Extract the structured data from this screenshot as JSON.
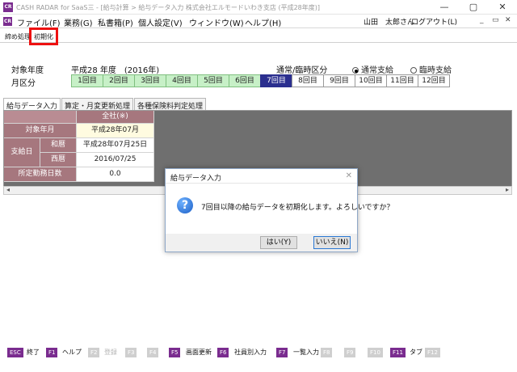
{
  "window": {
    "title": "CASH RADAR for SaaS三 - [給与計算 > 給与データ入力 株式会社エルモードいわき支店 (平成28年度)]",
    "app_icon": "CR"
  },
  "menu": {
    "items": [
      "ファイル(F)",
      "業務(G)",
      "私書箱(P)",
      "個人設定(V)",
      "ウィンドウ(W)",
      "ヘルプ(H)"
    ],
    "user": "山田　太郎さん",
    "logout": "ログアウト(L)"
  },
  "toolbar": {
    "items": [
      "締め処理",
      "初期化"
    ]
  },
  "header": {
    "year_label": "対象年度",
    "year_value": "平成28 年度　(2016年)",
    "type_label": "通常/臨時区分",
    "type_options": [
      "通常支給",
      "臨時支給"
    ],
    "type_selected": "通常支給",
    "month_label": "月区分",
    "periods": [
      "1回目",
      "2回目",
      "3回目",
      "4回目",
      "5回目",
      "6回目",
      "7回目",
      "8回目",
      "9回目",
      "10回目",
      "11回目",
      "12回目"
    ],
    "selected_period": "7回目"
  },
  "tabs": [
    "給与データ入力",
    "算定・月変更新処理",
    "各種保険料判定処理"
  ],
  "grid": {
    "company_header": "全社(※)",
    "target_month_label": "対象年月",
    "target_month_value": "平成28年07月",
    "payday_label": "支給日",
    "wareki_label": "和暦",
    "wareki_value": "平成28年07月25日",
    "seireki_label": "西暦",
    "seireki_value": "2016/07/25",
    "workdays_label": "所定勤務日数",
    "workdays_value": "0.0"
  },
  "dialog": {
    "title": "給与データ入力",
    "message": "7回目以降の給与データを初期化します。よろしいですか？",
    "yes": "はい(Y)",
    "no": "いいえ(N)"
  },
  "fkeys": [
    {
      "key": "ESC",
      "label": "終了",
      "enabled": true
    },
    {
      "key": "F1",
      "label": "ヘルプ",
      "enabled": true
    },
    {
      "key": "F2",
      "label": "登録",
      "enabled": false
    },
    {
      "key": "F3",
      "label": "",
      "enabled": false
    },
    {
      "key": "F4",
      "label": "",
      "enabled": false
    },
    {
      "key": "F5",
      "label": "画面更新",
      "enabled": true
    },
    {
      "key": "F6",
      "label": "社員別入力",
      "enabled": true
    },
    {
      "key": "F7",
      "label": "一覧入力",
      "enabled": true
    },
    {
      "key": "F8",
      "label": "",
      "enabled": false
    },
    {
      "key": "F9",
      "label": "",
      "enabled": false
    },
    {
      "key": "F10",
      "label": "",
      "enabled": false
    },
    {
      "key": "F11",
      "label": "タブ",
      "enabled": true
    },
    {
      "key": "F12",
      "label": "",
      "enabled": false
    }
  ]
}
